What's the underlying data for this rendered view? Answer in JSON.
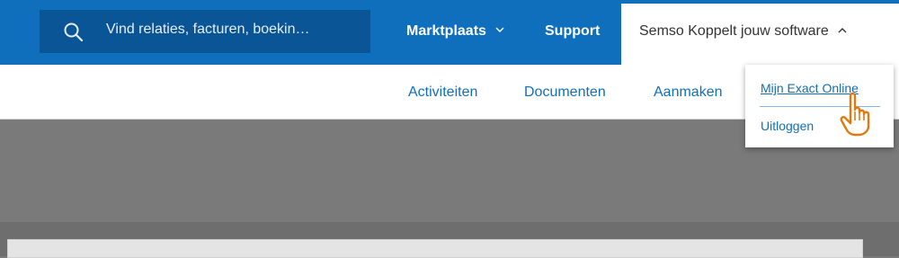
{
  "search": {
    "placeholder": "Vind relaties, facturen, boekin…",
    "icon": "search-icon"
  },
  "topnav": {
    "marketplace": "Marktplaats",
    "support": "Support",
    "account": "Semso Koppelt jouw software"
  },
  "subnav": {
    "items": [
      "Activiteiten",
      "Documenten",
      "Aanmaken"
    ]
  },
  "account_menu": {
    "items": [
      "Mijn Exact Online",
      "Uitloggen"
    ]
  },
  "colors": {
    "brand": "#0f6fbd",
    "search_bg": "#0a5596",
    "overlay": "#7a7a7a"
  }
}
